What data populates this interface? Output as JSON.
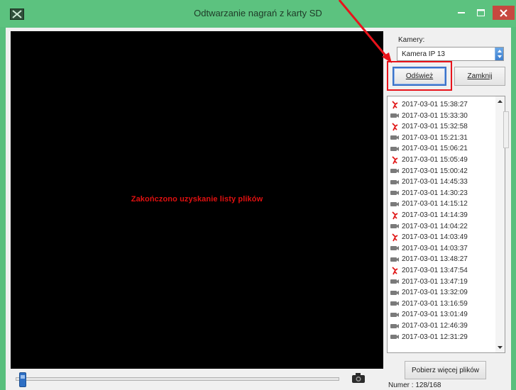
{
  "window": {
    "title": "Odtwarzanie nagrań z karty SD",
    "titlebar_color": "#5cc27f",
    "close_color": "#c7483f"
  },
  "video": {
    "status_message": "Zakończono uzyskanie listy plików",
    "message_color": "#e01010",
    "seek_progress": 0.0
  },
  "panel": {
    "cameras_label": "Kamery:",
    "camera_selected": "Kamera IP 13",
    "refresh_label": "Odśwież",
    "close_label": "Zamknij",
    "more_files_label": "Pobierz więcej plików",
    "numer_text": "Numer : 128/168"
  },
  "recordings": [
    {
      "time": "2017-03-01 15:38:27",
      "icon": "alarm-icon"
    },
    {
      "time": "2017-03-01 15:33:30",
      "icon": "camera-icon"
    },
    {
      "time": "2017-03-01 15:32:58",
      "icon": "alarm-icon"
    },
    {
      "time": "2017-03-01 15:21:31",
      "icon": "camera-icon"
    },
    {
      "time": "2017-03-01 15:06:21",
      "icon": "camera-icon"
    },
    {
      "time": "2017-03-01 15:05:49",
      "icon": "alarm-icon"
    },
    {
      "time": "2017-03-01 15:00:42",
      "icon": "camera-icon"
    },
    {
      "time": "2017-03-01 14:45:33",
      "icon": "camera-icon"
    },
    {
      "time": "2017-03-01 14:30:23",
      "icon": "camera-icon"
    },
    {
      "time": "2017-03-01 14:15:12",
      "icon": "camera-icon"
    },
    {
      "time": "2017-03-01 14:14:39",
      "icon": "alarm-icon"
    },
    {
      "time": "2017-03-01 14:04:22",
      "icon": "camera-icon"
    },
    {
      "time": "2017-03-01 14:03:49",
      "icon": "alarm-icon"
    },
    {
      "time": "2017-03-01 14:03:37",
      "icon": "camera-icon"
    },
    {
      "time": "2017-03-01 13:48:27",
      "icon": "camera-icon"
    },
    {
      "time": "2017-03-01 13:47:54",
      "icon": "alarm-icon"
    },
    {
      "time": "2017-03-01 13:47:19",
      "icon": "camera-icon"
    },
    {
      "time": "2017-03-01 13:32:09",
      "icon": "camera-icon"
    },
    {
      "time": "2017-03-01 13:16:59",
      "icon": "camera-icon"
    },
    {
      "time": "2017-03-01 13:01:49",
      "icon": "camera-icon"
    },
    {
      "time": "2017-03-01 12:46:39",
      "icon": "camera-icon"
    },
    {
      "time": "2017-03-01 12:31:29",
      "icon": "camera-icon"
    }
  ],
  "accent": {
    "highlight": "#e8131b",
    "focus_border": "#3b73c9"
  }
}
